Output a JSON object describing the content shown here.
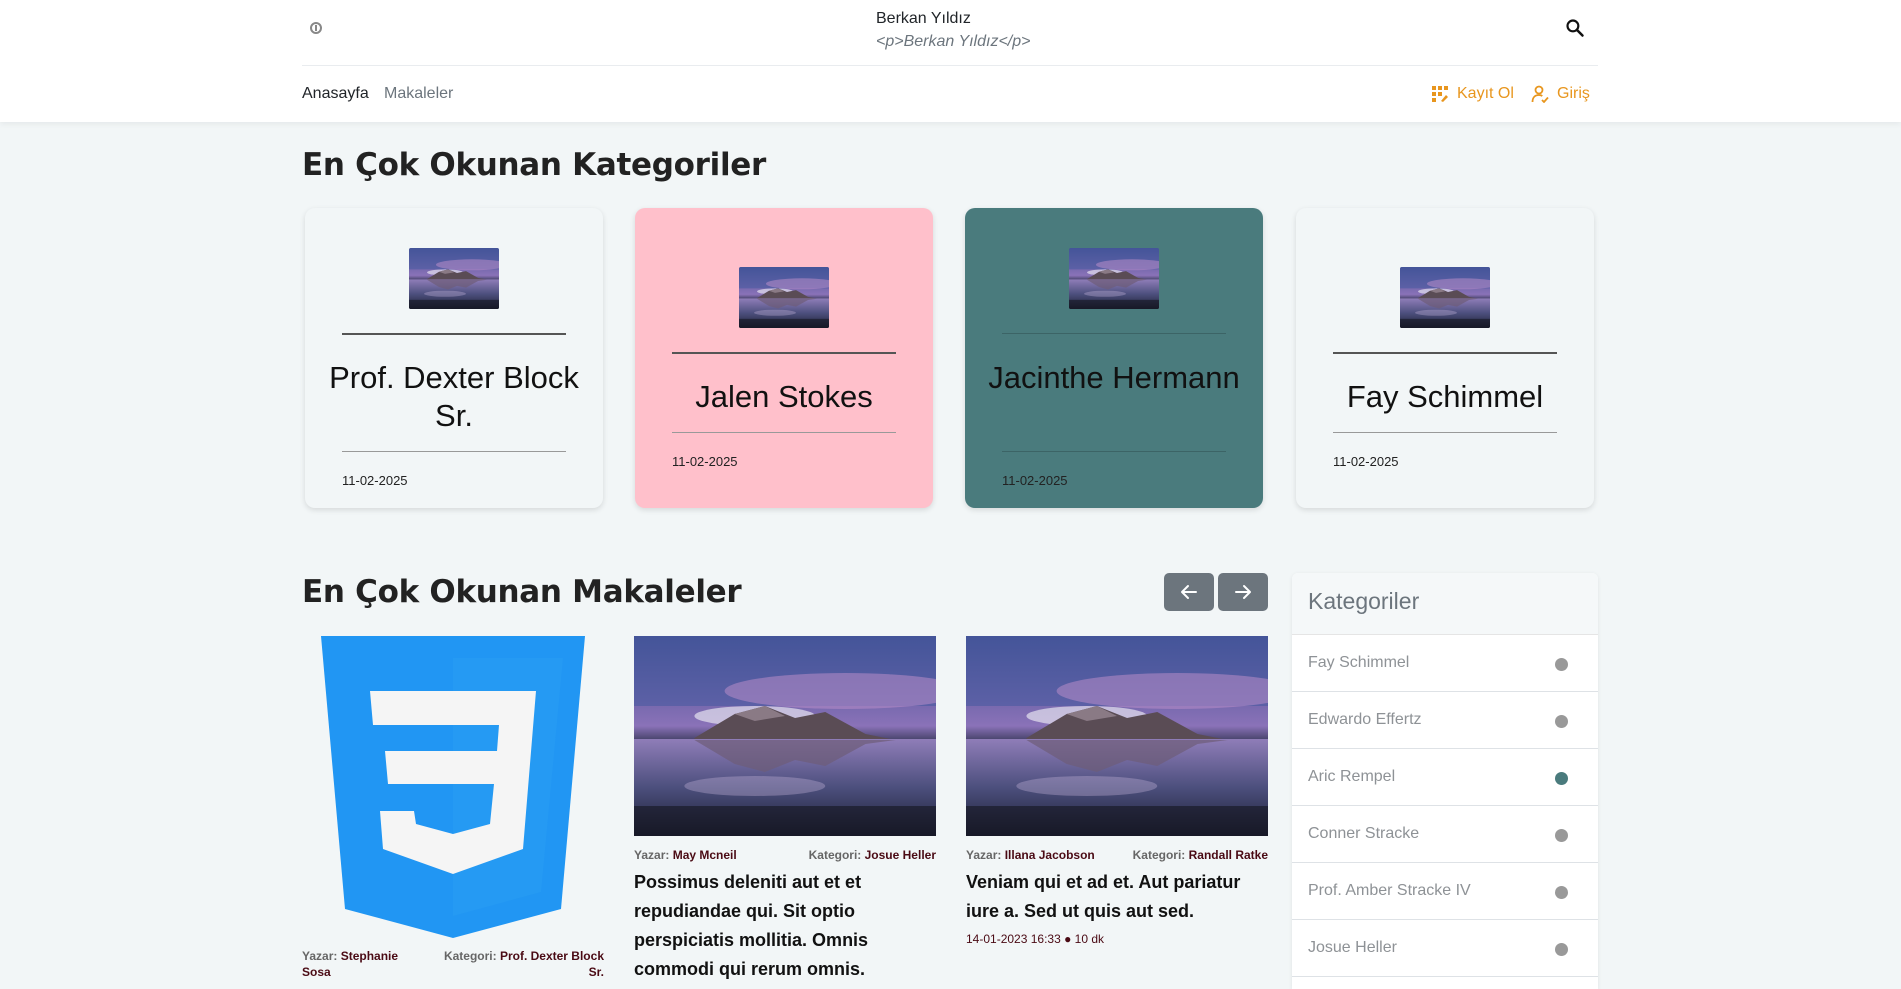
{
  "header": {
    "title": "Berkan Yıldız",
    "subtitle": "<p>Berkan Yıldız</p>",
    "nav": [
      {
        "label": "Anasayfa"
      },
      {
        "label": "Makaleler"
      }
    ],
    "register_label": "Kayıt Ol",
    "login_label": "Giriş"
  },
  "categories_section": {
    "title": "En Çok Okunan Kategoriler",
    "cards": [
      {
        "name": "Prof. Dexter Block Sr.",
        "date": "11-02-2025",
        "bg": "#f2f6f7"
      },
      {
        "name": "Jalen Stokes",
        "date": "11-02-2025",
        "bg": "#ffc0cb"
      },
      {
        "name": "Jacinthe Hermann",
        "date": "11-02-2025",
        "bg": "#4a7b7d"
      },
      {
        "name": "Fay Schimmel",
        "date": "11-02-2025",
        "bg": "#f2f6f7"
      }
    ]
  },
  "articles_section": {
    "title": "En Çok Okunan Makaleler",
    "author_label": "Yazar:",
    "category_label": "Kategori:",
    "articles": [
      {
        "author": "Stephanie Sosa",
        "category": "Prof. Dexter Block Sr.",
        "title": "",
        "date": ""
      },
      {
        "author": "May Mcneil",
        "category": "Josue Heller",
        "title": "Possimus deleniti aut et et repudiandae qui. Sit optio perspiciatis mollitia. Omnis commodi qui rerum omnis.",
        "date": ""
      },
      {
        "author": "Illana Jacobson",
        "category": "Randall Ratke",
        "title": "Veniam qui et ad et. Aut pariatur iure a. Sed ut quis aut sed.",
        "date": "14-01-2023 16:33 ● 10 dk"
      }
    ]
  },
  "sidebar": {
    "title": "Kategoriler",
    "items": [
      {
        "label": "Fay Schimmel",
        "dot": "#999999"
      },
      {
        "label": "Edwardo Effertz",
        "dot": "#999999"
      },
      {
        "label": "Aric Rempel",
        "dot": "#4a7b7d"
      },
      {
        "label": "Conner Stracke",
        "dot": "#999999"
      },
      {
        "label": "Prof. Amber Stracke IV",
        "dot": "#999999"
      },
      {
        "label": "Josue Heller",
        "dot": "#999999"
      }
    ]
  },
  "colors": {
    "accent": "#e8961e",
    "meta_value": "#4a0a14",
    "carousel_button": "#6c757d",
    "css3_logo": "#2196f3"
  }
}
